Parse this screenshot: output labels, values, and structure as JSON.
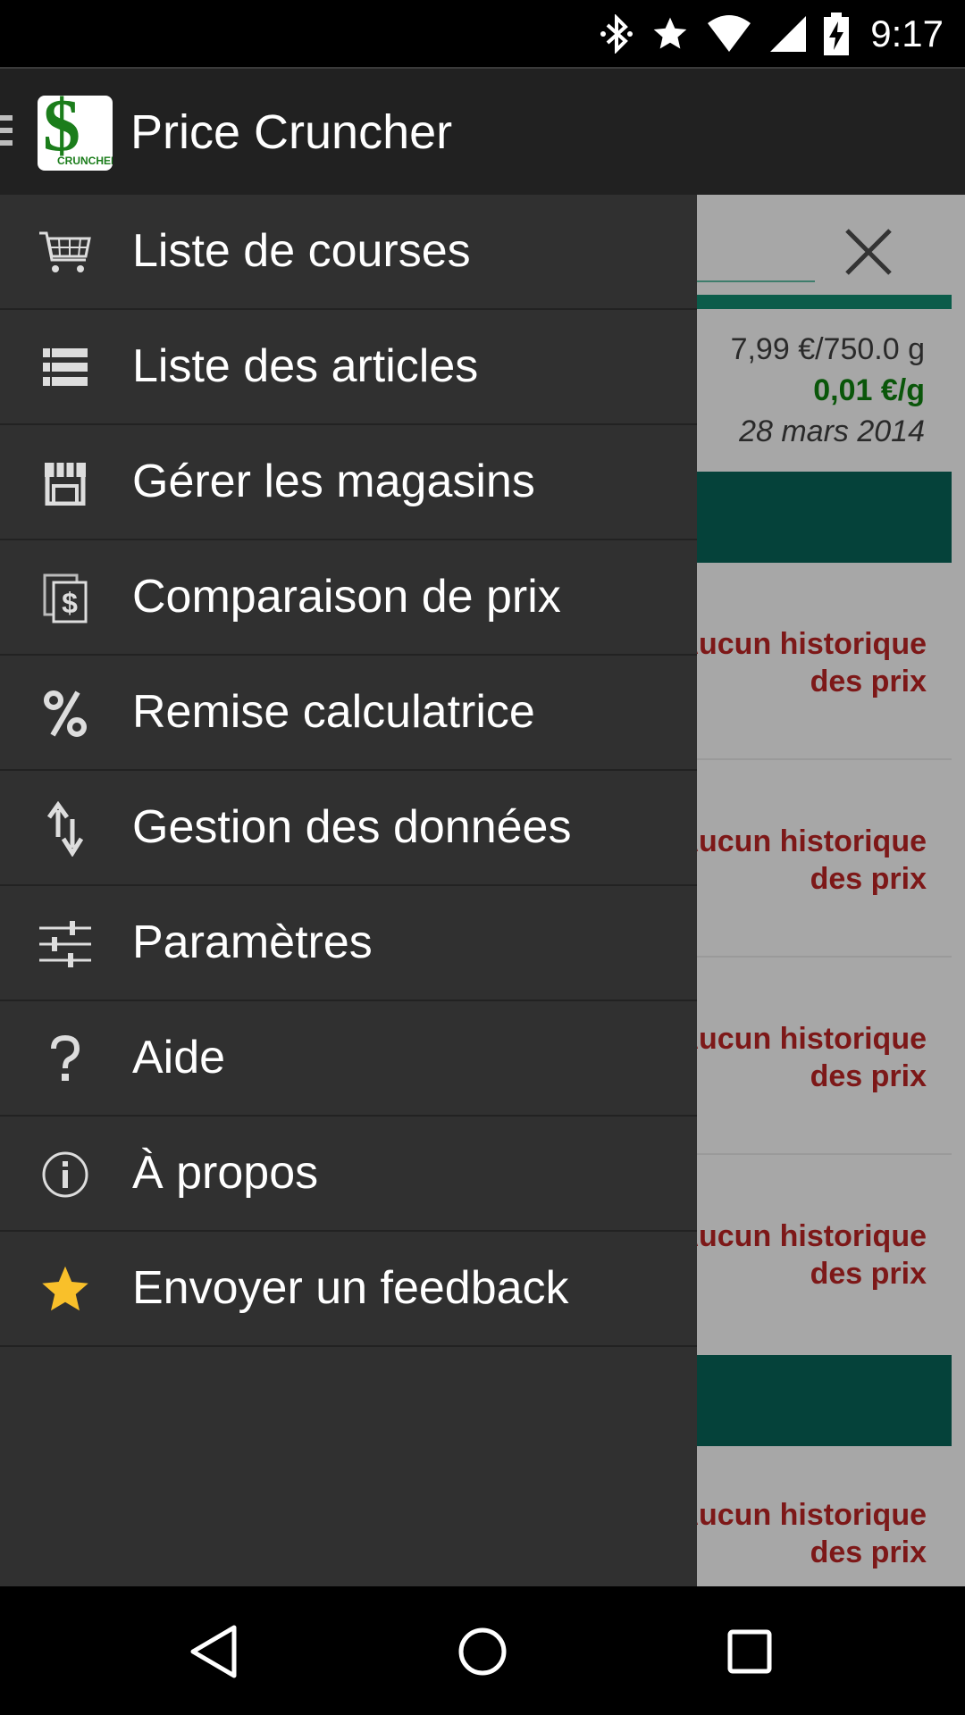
{
  "status_bar": {
    "time": "9:17",
    "icons": [
      "bluetooth-icon",
      "star-icon",
      "wifi-icon",
      "signal-icon",
      "battery-charging-icon"
    ]
  },
  "app_bar": {
    "title": "Price Cruncher",
    "logo_symbol": "$",
    "logo_text": "CRUNCHER"
  },
  "drawer": {
    "items": [
      {
        "label": "Liste de courses",
        "icon": "cart-icon"
      },
      {
        "label": "Liste des articles",
        "icon": "list-icon"
      },
      {
        "label": "Gérer les magasins",
        "icon": "store-icon"
      },
      {
        "label": "Comparaison de prix",
        "icon": "price-compare-icon"
      },
      {
        "label": "Remise calculatrice",
        "icon": "percent-icon"
      },
      {
        "label": "Gestion des données",
        "icon": "sort-arrows-icon"
      },
      {
        "label": "Paramètres",
        "icon": "sliders-icon"
      },
      {
        "label": "Aide",
        "icon": "help-icon"
      },
      {
        "label": "À propos",
        "icon": "info-icon"
      },
      {
        "label": "Envoyer un feedback",
        "icon": "star-icon"
      }
    ]
  },
  "background": {
    "price": "7,99 €/750.0 g",
    "unit_price": "0,01 €/g",
    "date": "28 mars 2014",
    "no_history_line1": "Aucun historique",
    "no_history_line2": "des prix",
    "accent_color": "#05423a",
    "warning_color": "#7d1818",
    "unit_price_color": "#0a560a"
  },
  "nav_bar": {
    "buttons": [
      "back-icon",
      "home-icon",
      "recents-icon"
    ]
  }
}
